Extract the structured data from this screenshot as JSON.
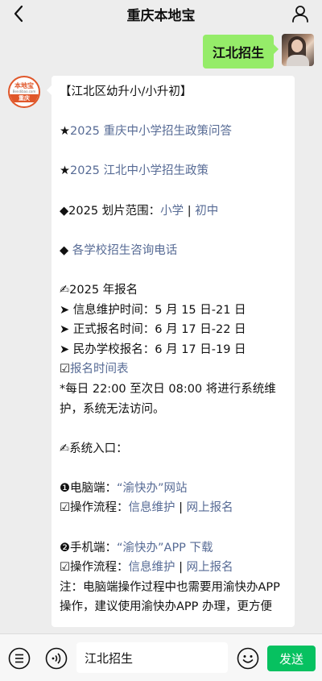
{
  "header": {
    "title": "重庆本地宝"
  },
  "user_message": {
    "text": "江北招生"
  },
  "bot": {
    "avatar": {
      "brand_text": "本地宝",
      "site_text": "Bendibao.com",
      "city_text": "重庆"
    },
    "message": {
      "heading": "【江北区幼升小/小升初】",
      "policy_qa": "★2025 重庆中小学招生政策问答",
      "policy_star": "★",
      "policy_qa_link": "2025 重庆中小学招生政策问答",
      "policy_jb_star": "★",
      "policy_jb_link": "2025 江北中小学招生政策",
      "zone_prefix": "◆2025 划片范围：",
      "zone_primary": "小学",
      "zone_sep": " | ",
      "zone_middle": "初中",
      "phone_prefix": "◆ ",
      "phone_link": "各学校招生咨询电话",
      "reg_title": "✍2025 年报名",
      "reg_info": "➤ 信息维护时间：5 月 15 日-21 日",
      "reg_formal": "➤ 正式报名时间：6 月 17 日-22 日",
      "reg_private": "➤ 民办学校报名：6 月 17 日-19 日",
      "reg_table_prefix": "☑",
      "reg_table_link": "报名时间表",
      "maintenance": "*每日 22:00 至次日 08:00 将进行系统维护，系统无法访问。",
      "entry_title": "✍系统入口：",
      "pc_prefix": "❶电脑端：",
      "pc_link": "“渝快办”网站",
      "pc_flow_prefix": "☑操作流程：",
      "pc_flow_link1": "信息维护",
      "pc_flow_sep": " | ",
      "pc_flow_link2": "网上报名",
      "mobile_prefix": "❷手机端：",
      "mobile_link": "“渝快办”APP 下载",
      "mobile_flow_prefix": "☑操作流程：",
      "mobile_flow_link1": "信息维护",
      "mobile_flow_sep": " | ",
      "mobile_flow_link2": "网上报名",
      "note": "注：电脑端操作过程中也需要用渝快办APP 操作，建议使用渝快办APP 办理，更方便"
    }
  },
  "input_bar": {
    "value": "江北招生",
    "send_label": "发送"
  },
  "colors": {
    "background": "#ededed",
    "user_bubble": "#95ec69",
    "link": "#576b95",
    "send_button": "#07c160",
    "brand_orange": "#e0572a"
  },
  "icons": {
    "back": "chevron-left-icon",
    "profile": "person-icon",
    "menu": "list-icon",
    "voice": "voice-icon",
    "emoji": "emoji-icon"
  }
}
